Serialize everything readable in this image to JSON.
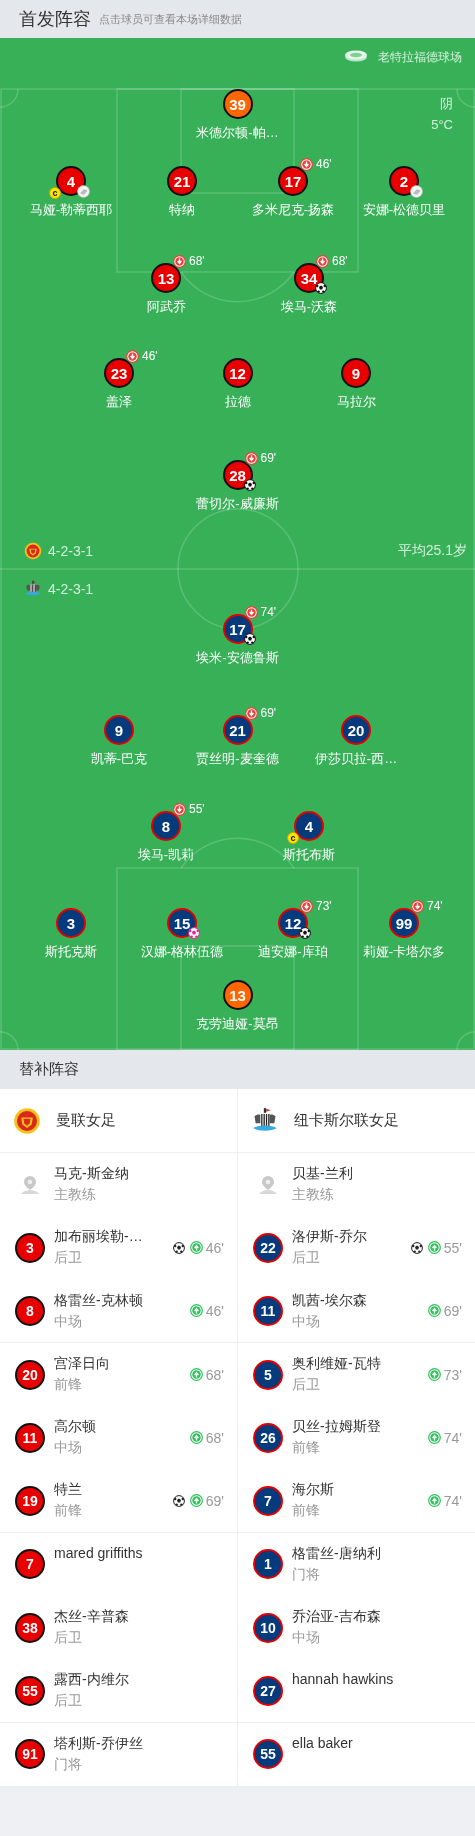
{
  "starting_header": {
    "title": "首发阵容",
    "hint": "点击球员可查看本场详细数据"
  },
  "pitch": {
    "stadium": "老特拉福德球场",
    "weather": "阴",
    "temperature": "5°C",
    "home": {
      "kind": "home",
      "formation": "4-2-3-1",
      "average_age": "平均25.1岁",
      "rows": [
        [
          {
            "number": "39",
            "name": "米德尔顿-帕…",
            "goalkeeper": true
          }
        ],
        [
          {
            "number": "4",
            "name": "马娅-勒蒂西耶",
            "goalkeeper": false,
            "captain_badge": "c",
            "marks": [
              {
                "kind": "assist"
              }
            ]
          },
          {
            "number": "21",
            "name": "特纳",
            "goalkeeper": false
          },
          {
            "number": "17",
            "name": "多米尼克-扬森",
            "goalkeeper": false,
            "sub_off": "46'"
          },
          {
            "number": "2",
            "name": "安娜-松德贝里",
            "goalkeeper": false,
            "marks": [
              {
                "kind": "assist"
              }
            ]
          }
        ],
        [
          {
            "number": "13",
            "name": "阿武乔",
            "goalkeeper": false,
            "sub_off": "68'"
          },
          {
            "number": "34",
            "name": "埃马-沃森",
            "goalkeeper": false,
            "sub_off": "68'",
            "marks": [
              {
                "kind": "goal"
              }
            ]
          }
        ],
        [
          {
            "number": "23",
            "name": "盖泽",
            "goalkeeper": false,
            "sub_off": "46'"
          },
          {
            "number": "12",
            "name": "拉德",
            "goalkeeper": false
          },
          {
            "number": "9",
            "name": "马拉尔",
            "goalkeeper": false
          }
        ],
        [
          {
            "number": "28",
            "name": "蕾切尔-威廉斯",
            "goalkeeper": false,
            "sub_off": "69'",
            "marks": [
              {
                "kind": "goal"
              }
            ]
          }
        ]
      ]
    },
    "away": {
      "kind": "away",
      "formation": "4-2-3-1",
      "rows": [
        [
          {
            "number": "17",
            "name": "埃米-安德鲁斯",
            "goalkeeper": false,
            "sub_off": "74'",
            "marks": [
              {
                "kind": "goal"
              }
            ]
          }
        ],
        [
          {
            "number": "9",
            "name": "凯蒂-巴克",
            "goalkeeper": false
          },
          {
            "number": "21",
            "name": "贾丝明-麦奎德",
            "goalkeeper": false,
            "sub_off": "69'"
          },
          {
            "number": "20",
            "name": "伊莎贝拉-西…",
            "goalkeeper": false
          }
        ],
        [
          {
            "number": "8",
            "name": "埃马-凯莉",
            "goalkeeper": false,
            "sub_off": "55'"
          },
          {
            "number": "4",
            "name": "斯托布斯",
            "goalkeeper": false,
            "captain_badge": "c"
          }
        ],
        [
          {
            "number": "3",
            "name": "斯托克斯",
            "goalkeeper": false
          },
          {
            "number": "15",
            "name": "汉娜-格林伍德",
            "goalkeeper": false,
            "marks": [
              {
                "kind": "own_goal"
              }
            ]
          },
          {
            "number": "12",
            "name": "迪安娜-库珀",
            "goalkeeper": false,
            "sub_off": "73'",
            "marks": [
              {
                "kind": "goal"
              }
            ]
          },
          {
            "number": "99",
            "name": "莉娅-卡塔尔多",
            "goalkeeper": false,
            "sub_off": "74'"
          }
        ],
        [
          {
            "number": "13",
            "name": "克劳迪娅-莫昂",
            "goalkeeper": true
          }
        ]
      ]
    }
  },
  "subs_header": {
    "title": "替补阵容"
  },
  "teams": [
    {
      "kind": "home",
      "name": "曼联女足",
      "coach": {
        "name": "马克-斯金纳",
        "role": "主教练"
      },
      "subs": [
        {
          "number": "3",
          "name": "加布丽埃勒-…",
          "position": "后卫",
          "goal": true,
          "sub_on": "46'"
        },
        {
          "number": "8",
          "name": "格雷丝-克林顿",
          "position": "中场",
          "goal": false,
          "sub_on": "46'"
        },
        {
          "number": "20",
          "name": "宫泽日向",
          "position": "前锋",
          "goal": false,
          "sub_on": "68'"
        },
        {
          "number": "11",
          "name": "高尔顿",
          "position": "中场",
          "goal": false,
          "sub_on": "68'"
        },
        {
          "number": "19",
          "name": "特兰",
          "position": "前锋",
          "goal": true,
          "sub_on": "69'"
        },
        {
          "number": "7",
          "name": "mared griffiths",
          "goal": false
        },
        {
          "number": "38",
          "name": "杰丝-辛普森",
          "position": "后卫",
          "goal": false
        },
        {
          "number": "55",
          "name": "露西-内维尔",
          "position": "后卫",
          "goal": false
        },
        {
          "number": "91",
          "name": "塔利斯-乔伊丝",
          "position": "门将",
          "goal": false
        }
      ]
    },
    {
      "kind": "away",
      "name": "纽卡斯尔联女足",
      "coach": {
        "name": "贝基-兰利",
        "role": "主教练"
      },
      "subs": [
        {
          "number": "22",
          "name": "洛伊斯-乔尔",
          "position": "后卫",
          "goal": true,
          "sub_on": "55'"
        },
        {
          "number": "11",
          "name": "凯茜-埃尔森",
          "position": "中场",
          "goal": false,
          "sub_on": "69'"
        },
        {
          "number": "5",
          "name": "奥利维娅-瓦特",
          "position": "后卫",
          "goal": false,
          "sub_on": "73'"
        },
        {
          "number": "26",
          "name": "贝丝-拉姆斯登",
          "position": "前锋",
          "goal": false,
          "sub_on": "74'"
        },
        {
          "number": "7",
          "name": "海尔斯",
          "position": "前锋",
          "goal": false,
          "sub_on": "74'"
        },
        {
          "number": "1",
          "name": "格雷丝-唐纳利",
          "position": "门将",
          "goal": false
        },
        {
          "number": "10",
          "name": "乔治亚-吉布森",
          "position": "中场",
          "goal": false
        },
        {
          "number": "27",
          "name": "hannah hawkins",
          "goal": false
        },
        {
          "number": "55",
          "name": "ella baker",
          "goal": false
        }
      ]
    }
  ]
}
